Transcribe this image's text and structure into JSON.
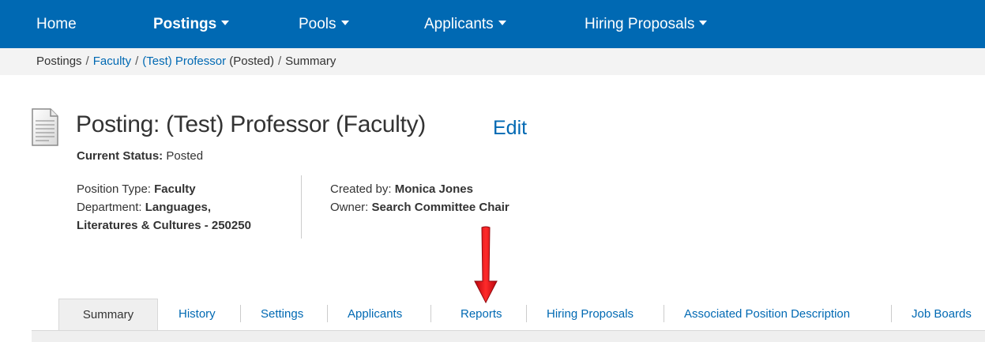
{
  "nav": {
    "items": [
      {
        "label": "Home",
        "dropdown": false,
        "active": false
      },
      {
        "label": "Postings",
        "dropdown": true,
        "active": true
      },
      {
        "label": "Pools",
        "dropdown": true,
        "active": false
      },
      {
        "label": "Applicants",
        "dropdown": true,
        "active": false
      },
      {
        "label": "Hiring Proposals",
        "dropdown": true,
        "active": false
      }
    ],
    "color": "#0069b3"
  },
  "breadcrumb": {
    "items": [
      "Postings",
      "Faculty",
      "(Test) Professor",
      "(Posted)",
      "Summary"
    ],
    "separator": "/"
  },
  "header": {
    "icon": "document-icon",
    "title": "Posting: (Test) Professor (Faculty)",
    "edit_label": "Edit",
    "status_label": "Current Status:",
    "status_value": "Posted"
  },
  "meta": {
    "position_type_label": "Position Type:",
    "position_type_value": "Faculty",
    "department_label": "Department:",
    "department_value_line1": "Languages,",
    "department_value_line2": "Literatures & Cultures - 250250",
    "created_by_label": "Created by:",
    "created_by_value": "Monica Jones",
    "owner_label": "Owner:",
    "owner_value": "Search Committee Chair"
  },
  "annotation": {
    "arrow_color": "#e0121b",
    "arrow_icon": "down-arrow-icon"
  },
  "tabs": [
    {
      "label": "Summary",
      "active": true
    },
    {
      "label": "History",
      "active": false
    },
    {
      "label": "Settings",
      "active": false
    },
    {
      "label": "Applicants",
      "active": false
    },
    {
      "label": "Reports",
      "active": false
    },
    {
      "label": "Hiring Proposals",
      "active": false
    },
    {
      "label": "Associated Position Description",
      "active": false
    },
    {
      "label": "Job Boards",
      "active": false
    }
  ]
}
